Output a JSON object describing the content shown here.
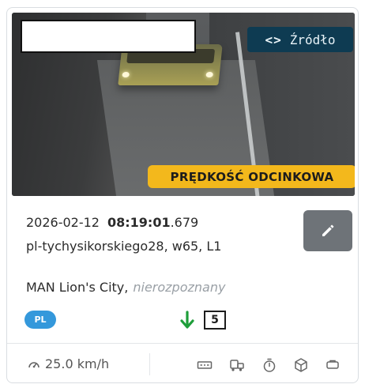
{
  "source_button": {
    "icon": "code-brackets-icon",
    "label": "Źródło"
  },
  "speed_badge": "PRĘDKOŚĆ ODCINKOWA",
  "record": {
    "date": "2026-02-12",
    "time": "08:19:01",
    "ms": ".679",
    "location": "pl-tychysikorskiego28, w65, L1"
  },
  "vehicle": {
    "make_model": "MAN Lion's City,",
    "status": "nierozpoznany"
  },
  "country": "PL",
  "lane": "5",
  "direction": {
    "icon": "arrow-down-icon",
    "color": "#1e9e3a"
  },
  "footer": {
    "speed": "25.0 km/h",
    "icons": [
      "plate-icon",
      "vehicle-class-icon",
      "timer-icon",
      "3d-box-icon",
      "tag-icon"
    ]
  },
  "colors": {
    "badge": "#f3b81c",
    "source": "#0e3b52",
    "country": "#3498db",
    "edit": "#6e7378"
  }
}
